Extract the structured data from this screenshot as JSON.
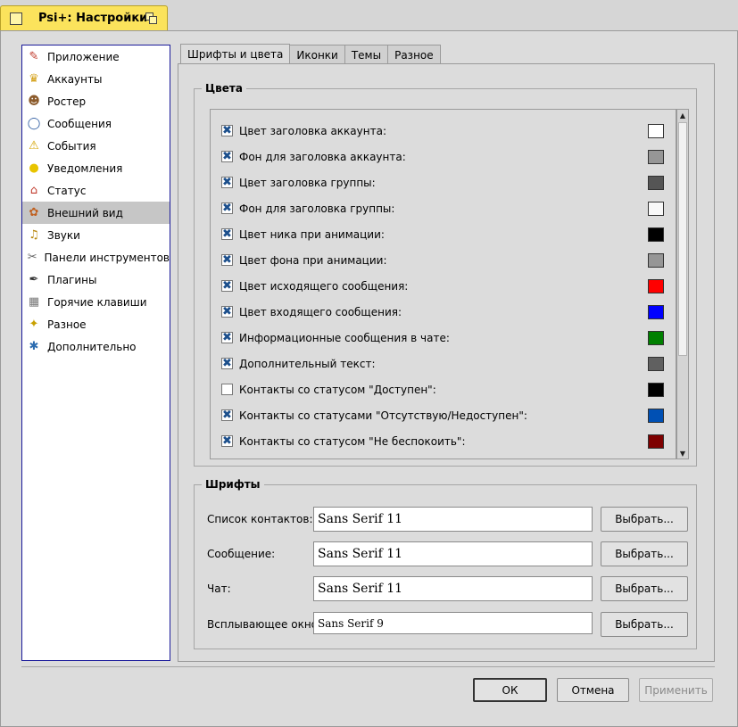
{
  "window": {
    "title": "Psi+: Настройки"
  },
  "sidebar": {
    "items": [
      {
        "label": "Приложение",
        "icon": "app-icon"
      },
      {
        "label": "Аккаунты",
        "icon": "accounts-icon"
      },
      {
        "label": "Ростер",
        "icon": "roster-icon"
      },
      {
        "label": "Сообщения",
        "icon": "messages-icon"
      },
      {
        "label": "События",
        "icon": "warning-icon"
      },
      {
        "label": "Уведомления",
        "icon": "lightbulb-icon"
      },
      {
        "label": "Статус",
        "icon": "status-icon"
      },
      {
        "label": "Внешний вид",
        "icon": "palette-icon",
        "selected": true
      },
      {
        "label": "Звуки",
        "icon": "bell-icon"
      },
      {
        "label": "Панели инструментов",
        "icon": "toolbar-icon"
      },
      {
        "label": "Плагины",
        "icon": "plugin-icon"
      },
      {
        "label": "Горячие клавиши",
        "icon": "keyboard-icon"
      },
      {
        "label": "Разное",
        "icon": "shield-icon"
      },
      {
        "label": "Дополнительно",
        "icon": "advanced-icon"
      }
    ]
  },
  "tabs": [
    {
      "label": "Шрифты и цвета",
      "active": true
    },
    {
      "label": "Иконки"
    },
    {
      "label": "Темы"
    },
    {
      "label": "Разное"
    }
  ],
  "colors": {
    "group_title": "Цвета",
    "items": [
      {
        "label": "Цвет заголовка аккаунта:",
        "checked": true,
        "color": "#ffffff"
      },
      {
        "label": "Фон для заголовка аккаунта:",
        "checked": true,
        "color": "#969696"
      },
      {
        "label": "Цвет заголовка группы:",
        "checked": true,
        "color": "#555555"
      },
      {
        "label": "Фон для заголовка группы:",
        "checked": true,
        "color": "#f8f8f8"
      },
      {
        "label": "Цвет ника при анимации:",
        "checked": true,
        "color": "#000000"
      },
      {
        "label": "Цвет фона при анимации:",
        "checked": true,
        "color": "#969696"
      },
      {
        "label": "Цвет исходящего сообщения:",
        "checked": true,
        "color": "#ff0000"
      },
      {
        "label": "Цвет входящего сообщения:",
        "checked": true,
        "color": "#0000ff"
      },
      {
        "label": "Информационные сообщения в чате:",
        "checked": true,
        "color": "#008000"
      },
      {
        "label": "Дополнительный текст:",
        "checked": true,
        "color": "#606060"
      },
      {
        "label": "Контакты со статусом \"Доступен\":",
        "checked": false,
        "color": "#000000"
      },
      {
        "label": "Контакты со статусами \"Отсутствую/Недоступен\":",
        "checked": true,
        "color": "#0050b4"
      },
      {
        "label": "Контакты со статусом \"Не беспокоить\":",
        "checked": true,
        "color": "#7e0000"
      }
    ]
  },
  "fonts": {
    "group_title": "Шрифты",
    "rows": [
      {
        "label": "Список контактов:",
        "value": "Sans Serif 11",
        "button": "Выбрать..."
      },
      {
        "label": "Сообщение:",
        "value": "Sans Serif 11",
        "button": "Выбрать..."
      },
      {
        "label": "Чат:",
        "value": "Sans Serif 11",
        "button": "Выбрать..."
      },
      {
        "label": "Всплывающее окно:",
        "value": "Sans Serif 9",
        "button": "Выбрать..."
      }
    ]
  },
  "buttons": {
    "ok": "ОК",
    "cancel": "Отмена",
    "apply": "Применить"
  }
}
